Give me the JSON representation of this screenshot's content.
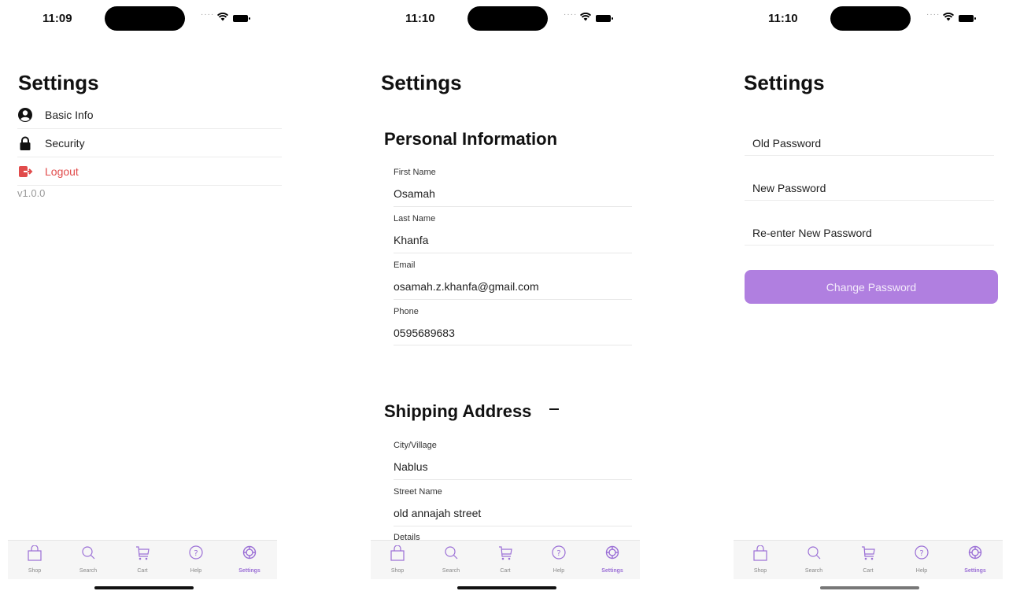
{
  "colors": {
    "accent": "#b07fe0",
    "tab_active": "#9b6fd6",
    "logout": "#e14b4b"
  },
  "screens": [
    {
      "time": "11:09",
      "title": "Settings",
      "menu": [
        {
          "label": "Basic Info",
          "icon": "user-circle-icon"
        },
        {
          "label": "Security",
          "icon": "lock-icon"
        },
        {
          "label": "Logout",
          "icon": "logout-icon"
        }
      ],
      "version": "v1.0.0"
    },
    {
      "time": "11:10",
      "title": "Settings",
      "personal_title": "Personal Information",
      "personal_fields": [
        {
          "label": "First Name",
          "value": "Osamah"
        },
        {
          "label": "Last Name",
          "value": "Khanfa"
        },
        {
          "label": "Email",
          "value": "osamah.z.khanfa@gmail.com"
        },
        {
          "label": "Phone",
          "value": "0595689683"
        }
      ],
      "shipping_title": "Shipping Address",
      "shipping_fields": [
        {
          "label": "City/Village",
          "value": "Nablus"
        },
        {
          "label": "Street Name",
          "value": "old annajah street"
        },
        {
          "label": "Details",
          "value": ""
        }
      ]
    },
    {
      "time": "11:10",
      "title": "Settings",
      "password_fields": [
        "Old Password",
        "New Password",
        "Re-enter New Password"
      ],
      "change_button": "Change Password"
    }
  ],
  "tabs": [
    {
      "label": "Shop",
      "icon": "bag-icon"
    },
    {
      "label": "Search",
      "icon": "search-icon"
    },
    {
      "label": "Cart",
      "icon": "cart-icon"
    },
    {
      "label": "Help",
      "icon": "help-icon"
    },
    {
      "label": "Settings",
      "icon": "settings-icon",
      "active": true
    }
  ]
}
